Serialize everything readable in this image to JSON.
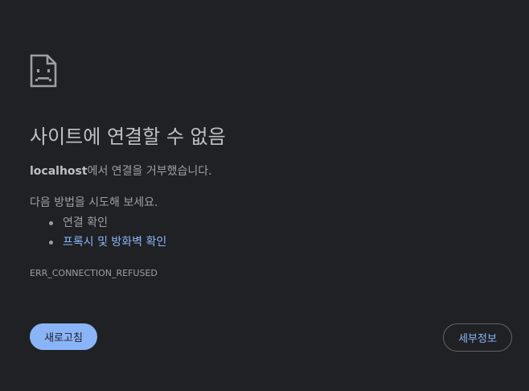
{
  "icon": "sad-document-icon",
  "colors": {
    "background": "#202124",
    "title": "#bdc1c6",
    "text": "#9aa0a6",
    "link": "#8ab4f8",
    "primary_button_bg": "#8ab4f8",
    "outline_border": "#5f6368"
  },
  "main": {
    "title": "사이트에 연결할 수 없음",
    "summary_host": "localhost",
    "summary_text": "에서 연결을 거부했습니다.",
    "suggestions_heading": "다음 방법을 시도해 보세요.",
    "suggestions": [
      {
        "label": "연결 확인"
      },
      {
        "label": "프록시 및 방화벽 확인"
      }
    ],
    "error_code": "ERR_CONNECTION_REFUSED"
  },
  "buttons": {
    "reload_label": "새로고침",
    "details_label": "세부정보"
  }
}
